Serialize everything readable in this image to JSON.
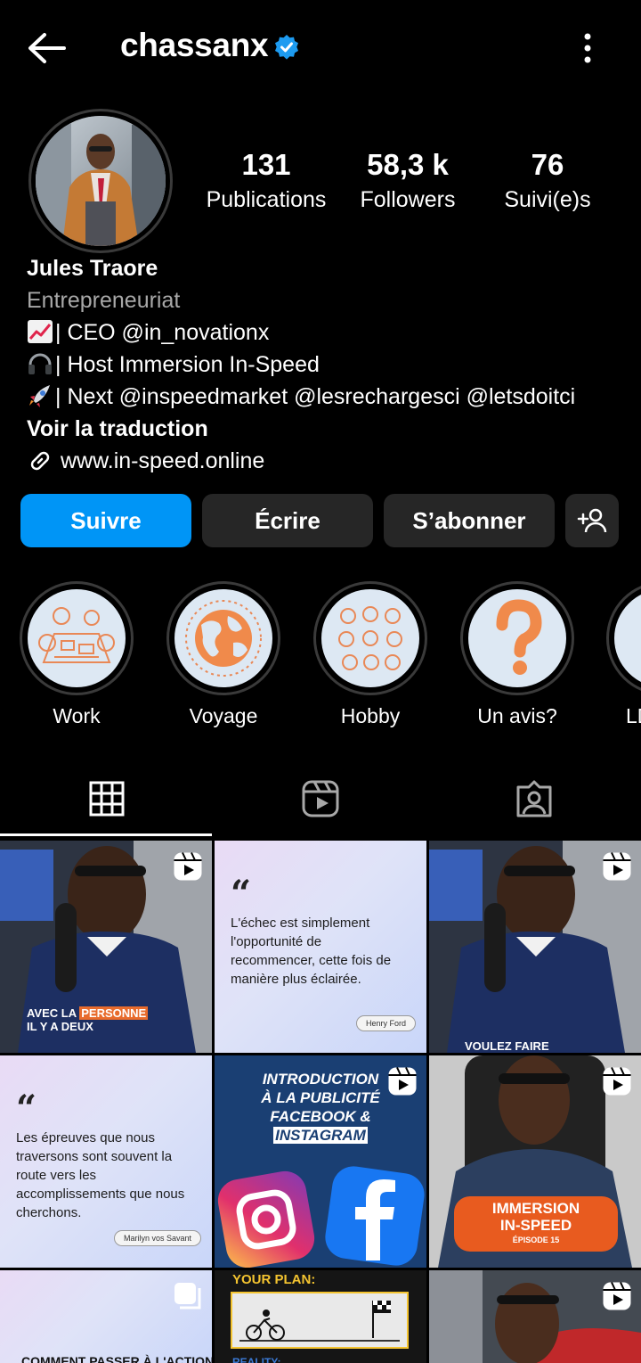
{
  "header": {
    "username": "chassanx",
    "back_icon": "arrow-left-icon",
    "verified_icon": "verified-badge-icon",
    "menu_icon": "kebab-menu-icon",
    "verified_color": "#1d9bf0"
  },
  "stats": [
    {
      "value": "131",
      "label": "Publications"
    },
    {
      "value": "58,3 k",
      "label": "Followers"
    },
    {
      "value": "76",
      "label": "Suivi(e)s"
    }
  ],
  "bio": {
    "name": "Jules Traore",
    "category": "Entrepreneuriat",
    "lines": [
      {
        "emoji": "chart-increasing-emoji",
        "text": "| CEO @in_novationx"
      },
      {
        "emoji": "headphones-emoji",
        "text": "| Host Immersion In-Speed"
      },
      {
        "emoji": "rocket-emoji",
        "text": "| Next @inspeedmarket @lesrechargesci @letsdoitci"
      }
    ],
    "translate": "Voir la traduction",
    "link": "www.in-speed.online"
  },
  "actions": {
    "follow": "Suivre",
    "message": "Écrire",
    "subscribe": "S’abonner",
    "add_user_icon": "add-person-icon",
    "follow_color": "#0095f6"
  },
  "highlights": [
    {
      "label": "Work"
    },
    {
      "label": "Voyage"
    },
    {
      "label": "Hobby"
    },
    {
      "label": "Un avis?"
    },
    {
      "label": "LD"
    }
  ],
  "tabs": [
    {
      "icon": "grid-icon",
      "active": true
    },
    {
      "icon": "reels-icon",
      "active": false
    },
    {
      "icon": "tagged-icon",
      "active": false
    }
  ],
  "posts": {
    "p1_caption_a": "AVEC LA ",
    "p1_caption_b": "PERSONNE",
    "p1_caption_c": "IL Y A DEUX",
    "p2_quote": "L'échec est simplement l'opportunité de recommencer, cette fois de manière plus éclairée.",
    "p2_author": "Henry Ford",
    "p3_caption": "VOULEZ FAIRE",
    "p4_quote": "Les épreuves que nous traversons sont souvent la route vers les accomplissements que nous cherchons.",
    "p4_author": "Marilyn vos Savant",
    "p5_title_1": "INTRODUCTION",
    "p5_title_2": "À LA PUBLICITÉ",
    "p5_title_3": "FACEBOOK &",
    "p5_title_4": "INSTAGRAM",
    "p6_title_1": "IMMERSION",
    "p6_title_2": "IN-SPEED",
    "p6_sub": "ÉPISODE 15",
    "p7_caption": "COMMENT PASSER À L'ACTION ?",
    "p8_title": "YOUR PLAN:",
    "p8_sub": "REALITY:"
  }
}
